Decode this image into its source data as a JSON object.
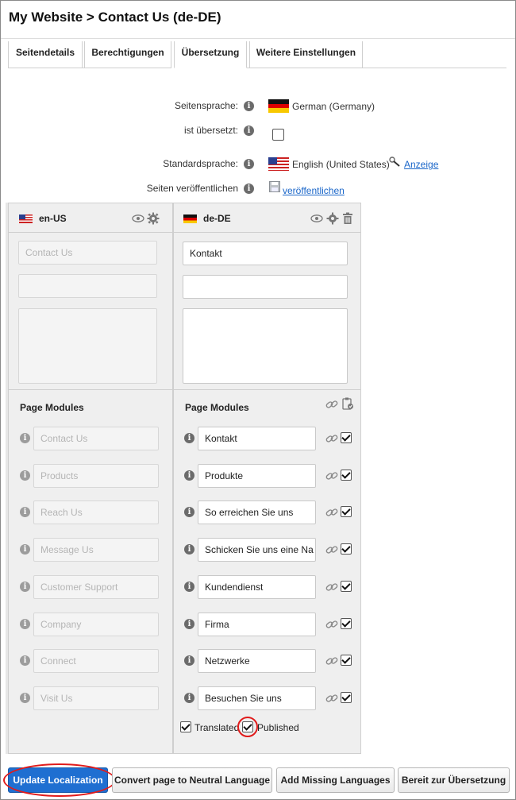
{
  "header": {
    "title": "My Website > Contact Us (de-DE)"
  },
  "tabs": [
    {
      "label": "Seitendetails"
    },
    {
      "label": "Berechtigungen"
    },
    {
      "label": "Übersetzung"
    },
    {
      "label": "Weitere Einstellungen"
    }
  ],
  "properties": {
    "page_language_label": "Seitensprache:",
    "page_language_value": "German (Germany)",
    "translated_label": "ist übersetzt:",
    "default_language_label": "Standardsprache:",
    "default_language_value": "English (United States)",
    "view_link": "Anzeige",
    "publish_label": "Seiten veröffentlichen",
    "publish_link": "veröffentlichen"
  },
  "source": {
    "lang": "en-US",
    "title_placeholder": "Contact Us",
    "module_heading": "Page Modules",
    "modules": [
      "Contact Us",
      "Products",
      "Reach Us",
      "Message Us",
      "Customer Support",
      "Company",
      "Connect",
      "Visit Us"
    ]
  },
  "target": {
    "lang": "de-DE",
    "title_value": "Kontakt",
    "module_heading": "Page Modules",
    "modules": [
      "Kontakt",
      "Produkte",
      "So erreichen Sie uns",
      "Schicken Sie uns eine Na",
      "Kundendienst",
      "Firma",
      "Netzwerke",
      "Besuchen Sie uns"
    ],
    "translated_label": "Translated",
    "published_label": "Published"
  },
  "buttons": {
    "update": "Update Localization",
    "convert": "Convert page to Neutral Language",
    "add_missing": "Add Missing Languages",
    "ready": "Bereit zur Übersetzung"
  },
  "colors": {
    "primary_button": "#1f6fd1",
    "link": "#1a66c9",
    "highlight": "#e01b1b"
  }
}
